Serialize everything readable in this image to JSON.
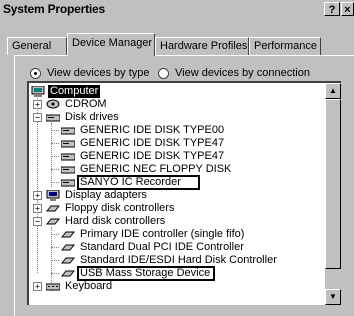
{
  "window": {
    "title": "System Properties",
    "help_label": "?",
    "close_label": "×"
  },
  "tabs": [
    {
      "label": "General"
    },
    {
      "label": "Device Manager"
    },
    {
      "label": "Hardware Profiles"
    },
    {
      "label": "Performance"
    }
  ],
  "view_options": {
    "by_type": "View devices by type",
    "by_connection": "View devices by connection",
    "selected": "by_type"
  },
  "tree": {
    "root": "Computer",
    "nodes": [
      {
        "label": "CDROM",
        "expander": "+",
        "icon": "cdrom-icon"
      },
      {
        "label": "Disk drives",
        "expander": "−",
        "icon": "disk-drive-icon"
      },
      {
        "label": "GENERIC IDE  DISK TYPE00",
        "icon": "disk-drive-icon"
      },
      {
        "label": "GENERIC IDE  DISK TYPE47",
        "icon": "disk-drive-icon"
      },
      {
        "label": "GENERIC IDE  DISK TYPE47",
        "icon": "disk-drive-icon"
      },
      {
        "label": "GENERIC NEC  FLOPPY DISK",
        "icon": "disk-drive-icon"
      },
      {
        "label": "SANYO IC Recorder",
        "icon": "disk-drive-icon",
        "highlighted": true
      },
      {
        "label": "Display adapters",
        "expander": "+",
        "icon": "display-adapter-icon"
      },
      {
        "label": "Floppy disk controllers",
        "expander": "+",
        "icon": "controller-icon"
      },
      {
        "label": "Hard disk controllers",
        "expander": "−",
        "icon": "controller-icon"
      },
      {
        "label": "Primary IDE controller (single fifo)",
        "icon": "controller-icon"
      },
      {
        "label": "Standard Dual PCI IDE Controller",
        "icon": "controller-icon"
      },
      {
        "label": "Standard IDE/ESDI Hard Disk Controller",
        "icon": "controller-icon"
      },
      {
        "label": "USB Mass Storage Device",
        "icon": "controller-icon",
        "highlighted": true
      },
      {
        "label": "Keyboard",
        "expander": "+",
        "icon": "keyboard-icon"
      }
    ]
  }
}
